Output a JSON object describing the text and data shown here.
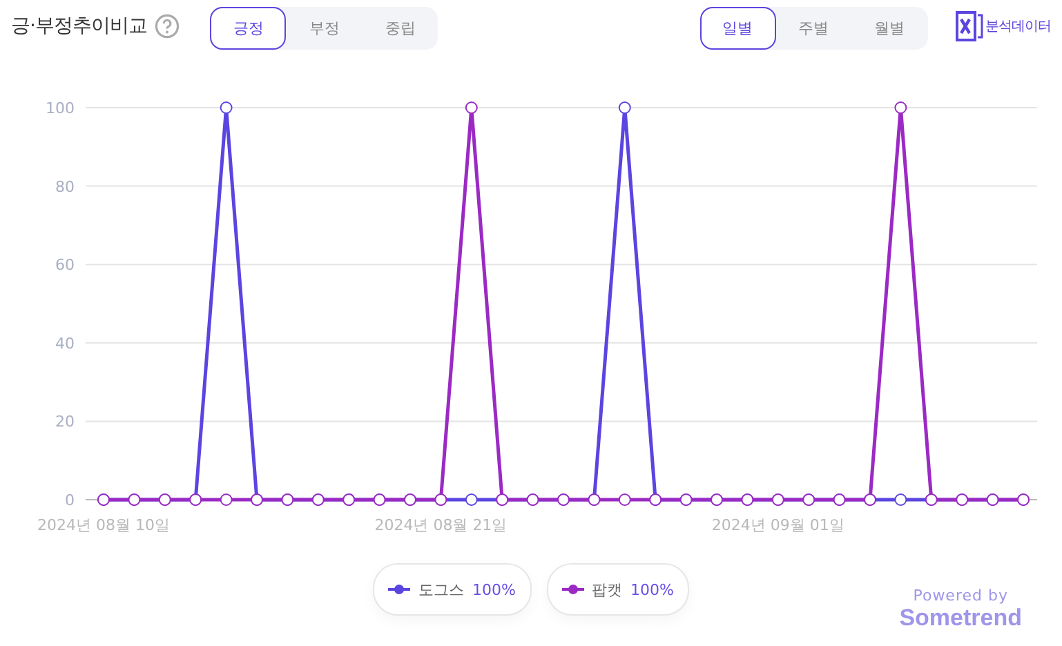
{
  "title": "긍·부정추이비교",
  "sentiment_tabs": [
    {
      "label": "긍정",
      "selected": true
    },
    {
      "label": "부정",
      "selected": false
    },
    {
      "label": "중립",
      "selected": false
    }
  ],
  "period_tabs": [
    {
      "label": "일별",
      "selected": true
    },
    {
      "label": "주별",
      "selected": false
    },
    {
      "label": "월별",
      "selected": false
    }
  ],
  "export_label": "분석데이터",
  "chart_data": {
    "type": "line",
    "categories": [
      "2024년 08월 10일",
      null,
      null,
      null,
      null,
      null,
      null,
      null,
      null,
      null,
      null,
      "2024년 08월 21일",
      null,
      null,
      null,
      null,
      null,
      null,
      null,
      null,
      null,
      null,
      "2024년 09월 01일",
      null,
      null,
      null,
      null,
      null,
      null,
      null,
      null
    ],
    "grid": true,
    "ylim": [
      0,
      100
    ],
    "yticks": [
      0,
      20,
      40,
      60,
      80,
      100
    ],
    "series": [
      {
        "name": "도그스",
        "color": "#5b45e0",
        "marker": "circle",
        "values": [
          0,
          0,
          0,
          0,
          100,
          0,
          0,
          0,
          0,
          0,
          0,
          0,
          0,
          0,
          0,
          0,
          0,
          100,
          0,
          0,
          0,
          0,
          0,
          0,
          0,
          0,
          0,
          0,
          0,
          0,
          0
        ]
      },
      {
        "name": "팝캣",
        "color": "#9b2ac4",
        "marker": "circle",
        "values": [
          0,
          0,
          0,
          0,
          0,
          0,
          0,
          0,
          0,
          0,
          0,
          0,
          100,
          0,
          0,
          0,
          0,
          0,
          0,
          0,
          0,
          0,
          0,
          0,
          0,
          0,
          100,
          0,
          0,
          0,
          0
        ]
      }
    ]
  },
  "legend": [
    {
      "value": "100%"
    },
    {
      "value": "100%"
    }
  ],
  "powered_by": "Powered by",
  "brand": "Sometrend"
}
